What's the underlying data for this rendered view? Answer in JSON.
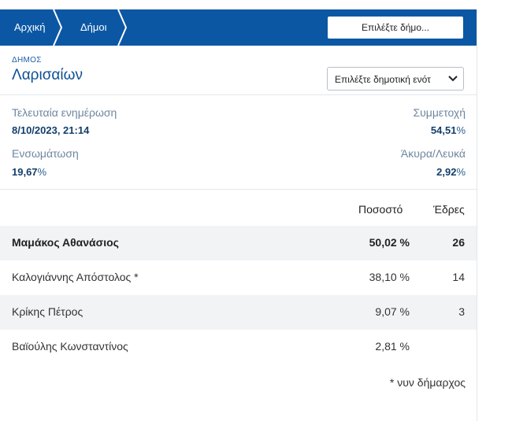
{
  "breadcrumb": {
    "home_label": "Αρχική",
    "municipalities_label": "Δήμοι"
  },
  "municipality_select_label": "Επιλέξτε δήμο...",
  "municipality": {
    "type_label": "ΔΗΜΟΣ",
    "name": "Λαρισαίων",
    "unit_select_value": "Επιλέξτε δημοτική ενότ"
  },
  "stats": {
    "last_update_label": "Τελευταία ενημέρωση",
    "last_update_value": "8/10/2023, 21:14",
    "turnout_label": "Συμμετοχή",
    "turnout_value": "54,51",
    "integration_label": "Ενσωμάτωση",
    "integration_value": "19,67",
    "invalid_blank_label": "Άκυρα/Λευκά",
    "invalid_blank_value": "2,92",
    "percent_sign": "%"
  },
  "results": {
    "headers": {
      "percent": "Ποσοστό",
      "seats": "Έδρες"
    },
    "rows": [
      {
        "name": "Μαμάκος Αθανάσιος",
        "percent": "50,02 %",
        "seats": "26"
      },
      {
        "name": "Καλογιάννης Απόστολος *",
        "percent": "38,10 %",
        "seats": "14"
      },
      {
        "name": "Κρίκης Πέτρος",
        "percent": "9,07 %",
        "seats": "3"
      },
      {
        "name": "Βαϊούλης Κωνσταντίνος",
        "percent": "2,81 %",
        "seats": ""
      }
    ],
    "footnote": "* νυν δήμαρχος"
  },
  "colors": {
    "header_blue": "#0b57a4",
    "row_shade": "#f2f3f5"
  },
  "icons": [
    "chevron-right-icon",
    "chevron-down-icon"
  ]
}
